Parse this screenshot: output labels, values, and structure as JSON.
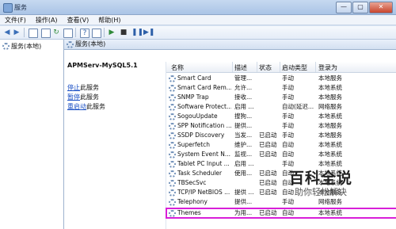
{
  "window": {
    "title": "服务",
    "minimize": "—",
    "maximize": "▢",
    "close": "✕"
  },
  "menu": [
    "文件(F)",
    "操作(A)",
    "查看(V)",
    "帮助(H)"
  ],
  "left": {
    "tree_label": "服务(本地)"
  },
  "right": {
    "header": "服务(本地)",
    "service_name": "APMServ-MySQL5.1",
    "actions": [
      {
        "link": "停止",
        "suffix": "此服务"
      },
      {
        "link": "暂停",
        "suffix": "此服务"
      },
      {
        "link": "重启动",
        "suffix": "此服务"
      }
    ]
  },
  "table": {
    "columns": [
      "名称",
      "描述",
      "状态",
      "启动类型",
      "登录为"
    ],
    "rows": [
      {
        "name": "Smart Card",
        "desc": "管理...",
        "state": "",
        "start": "手动",
        "logon": "本地服务"
      },
      {
        "name": "Smart Card Rem...",
        "desc": "允许...",
        "state": "",
        "start": "手动",
        "logon": "本地系统"
      },
      {
        "name": "SNMP Trap",
        "desc": "接收...",
        "state": "",
        "start": "手动",
        "logon": "本地服务"
      },
      {
        "name": "Software Protect...",
        "desc": "启用 ...",
        "state": "",
        "start": "自动(延迟...",
        "logon": "网络服务"
      },
      {
        "name": "SogouUpdate",
        "desc": "搜狗...",
        "state": "",
        "start": "手动",
        "logon": "本地系统"
      },
      {
        "name": "SPP Notification ...",
        "desc": "提供...",
        "state": "",
        "start": "手动",
        "logon": "本地服务"
      },
      {
        "name": "SSDP Discovery",
        "desc": "当发...",
        "state": "已启动",
        "start": "手动",
        "logon": "本地服务"
      },
      {
        "name": "Superfetch",
        "desc": "维护...",
        "state": "已启动",
        "start": "自动",
        "logon": "本地系统"
      },
      {
        "name": "System Event N...",
        "desc": "监视...",
        "state": "已启动",
        "start": "自动",
        "logon": "本地系统"
      },
      {
        "name": "Tablet PC Input ...",
        "desc": "启用 ...",
        "state": "",
        "start": "手动",
        "logon": "本地系统"
      },
      {
        "name": "Task Scheduler",
        "desc": "使用...",
        "state": "已启动",
        "start": "自动",
        "logon": "本地系统"
      },
      {
        "name": "TBSecSvc",
        "desc": "",
        "state": "已启动",
        "start": "自动",
        "logon": "本地系统"
      },
      {
        "name": "TCP/IP NetBIOS ...",
        "desc": "提供 ...",
        "state": "已启动",
        "start": "自动",
        "logon": "本地服务"
      },
      {
        "name": "Telephony",
        "desc": "提供...",
        "state": "",
        "start": "手动",
        "logon": "网络服务"
      },
      {
        "name": "Themes",
        "desc": "为用...",
        "state": "已启动",
        "start": "自动",
        "logon": "本地系统"
      }
    ]
  },
  "watermark": {
    "title": "百科全说",
    "subtitle": "助你轻松解决"
  }
}
